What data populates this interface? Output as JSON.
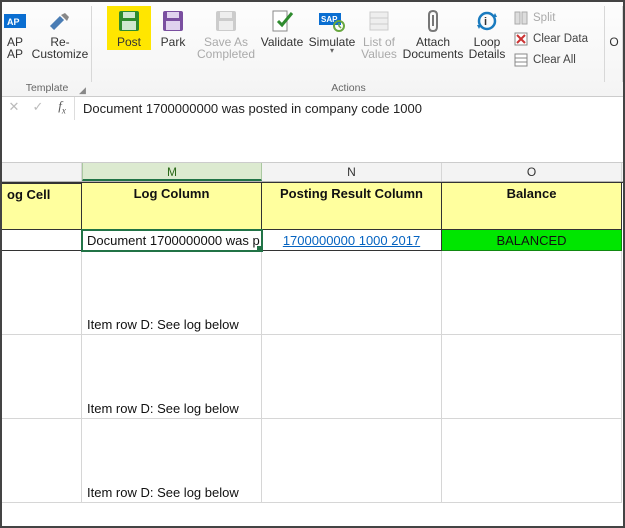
{
  "ribbon": {
    "sap_btn": "AP",
    "sap_sub": "AP",
    "recustomize": "Re-\nCustomize",
    "template_group": "Template",
    "post": "Post",
    "park": "Park",
    "save_completed": "Save As\nCompleted",
    "validate": "Validate",
    "simulate": "Simulate",
    "list_values": "List of\nValues",
    "attach_docs": "Attach\nDocuments",
    "loop_details": "Loop\nDetails",
    "split": "Split",
    "clear_data": "Clear Data",
    "clear_all": "Clear All",
    "actions_group": "Actions",
    "o_cut": "O"
  },
  "formula_bar": {
    "value": "Document 1700000000 was posted in company code 1000"
  },
  "columns": {
    "m": "M",
    "n": "N",
    "o": "O"
  },
  "headers": {
    "stub": "og Cell",
    "log_column": "Log Column",
    "posting_result": "Posting Result Column",
    "balance": "Balance"
  },
  "rows": {
    "r1": {
      "log": "Document 1700000000 was p",
      "posting": "1700000000 1000 2017",
      "balance": "BALANCED"
    },
    "r2": {
      "log": "Item row D: See log below"
    },
    "r3": {
      "log": "Item row D: See log below"
    },
    "r4": {
      "log": "Item row D: See log below"
    }
  }
}
